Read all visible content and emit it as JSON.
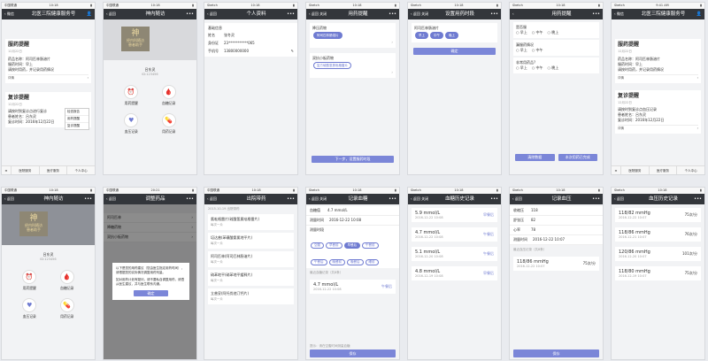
{
  "status": {
    "carrier": "中国联通",
    "carrier2": "中国移动",
    "carrier3": "Sketch"
  },
  "p1": {
    "time": "10:18",
    "back": "微信",
    "title": "北医三院健康服务号",
    "remind_title": "服药提醒",
    "remind_date": "12月22日",
    "drug": "药品名称：阿司匹林肠溶片",
    "time_line": "服药时间：早上",
    "note": "请按时用药，并记录用药情况",
    "detail": "详情",
    "visit_title": "复诊提醒",
    "visit_date": "12月22日",
    "visit_line1": "请按时到复诊点进行复诊",
    "visit_line2": "患者姓名：吕东灵",
    "visit_line3": "复诊时间：2016年12月22日",
    "popup": [
      "检查报告",
      "用药提醒",
      "复诊提醒"
    ],
    "tabs": [
      "≡",
      "医院服务",
      "医疗服务",
      "个人中心"
    ]
  },
  "p2": {
    "time": "10:18",
    "back": "返回",
    "title": "神内随访",
    "badge1": "神",
    "badge2": "经内科随访",
    "badge3": "患者助手",
    "name": "吕东灵",
    "id": "ID:123456",
    "menu": [
      "用药提醒",
      "血糖记录",
      "血压记录",
      "用药记录"
    ]
  },
  "p3": {
    "time": "10:18",
    "back": "返回",
    "title": "个人资料",
    "section": "基础信息",
    "rows": [
      {
        "k": "姓名",
        "v": "张冬灵"
      },
      {
        "k": "身份证",
        "v": "23***********065"
      },
      {
        "k": "手机号",
        "v": "13800000000"
      }
    ]
  },
  "p4": {
    "time": "10:18",
    "back": "返回",
    "close": "关闭",
    "title": "用药提醒",
    "s1": "降压药物",
    "chip1": "阿司匹林肠溶片",
    "s2": "双抗小板药物",
    "chip2": "复方硫酸氢氯吡格雷片",
    "btn": "下一步，设置服药时段"
  },
  "p5": {
    "time": "10:18",
    "back": "返回",
    "close": "关闭",
    "title": "设置用药时段",
    "drug": "阿司匹林肠溶片",
    "chips": [
      "早上",
      "中午",
      "晚上"
    ],
    "btn": "确定"
  },
  "p6": {
    "time": "10:18",
    "title": "用药提醒",
    "q1": "是否服",
    "opts": [
      "早上",
      "中午",
      "晚上"
    ],
    "q2": "漏服药情况",
    "q3": "非常用药品?",
    "cancel": "清除数据",
    "ok": "本次用药已完成"
  },
  "p7": {
    "time": "9:41 AM",
    "back": "微信",
    "title": "北医三院健康服务号",
    "remind_title": "服药提醒",
    "remind_date": "12月22日",
    "drug": "药品名称：阿司匹林肠溶片",
    "time_line": "服药时间：早上",
    "note": "请按时用药，并记录用药情况",
    "detail": "详情",
    "visit_title": "复诊提醒",
    "visit_date": "12月22日",
    "visit_line1": "请按时到复诊点血压记录",
    "visit_line2": "患者姓名：吕东灵",
    "visit_line3": "复诊时间：2016年12月22日",
    "tabs": [
      "≡",
      "医院服务",
      "医疗服务",
      "个人中心"
    ]
  },
  "p8": {
    "time": "10:18",
    "back": "返回",
    "title": "神内随访",
    "badge1": "神",
    "badge2": "经内科随访",
    "badge3": "患者助手",
    "name": "吕东灵",
    "id": "ID:123456",
    "menu": [
      "用药提醒",
      "血糖记录",
      "血压记录",
      "用药记录"
    ]
  },
  "p9": {
    "time": "20:21",
    "back": "返回",
    "title": "调整药品",
    "items": [
      "阿司匹林",
      "降糖药物",
      "双抗小板药物"
    ],
    "dialog1": "以下是您的用药建议（您由医生指定用药时间），请根据您的实际情况调整用药剂量。",
    "dialog2": "如对用药计划有疑问，请不要私自调整用药，请遵从医生建议，并与医生联系沟通。",
    "dialog_btn": "确定"
  },
  "p10": {
    "time": "10:18",
    "back": "返回",
    "title": "出院带药",
    "date": "2015-10-19 出院带药",
    "items": [
      {
        "n": "氯吡格雷片(硫酸氢氯吡格雷片)",
        "f": "每次一片"
      },
      {
        "n": "培达普(苯磺酸氨氯地平片)",
        "f": "每次一片"
      },
      {
        "n": "阿司匹林(阿司匹林肠溶片)",
        "f": "每次一片"
      },
      {
        "n": "硝苯地平(硝苯地平缓释片)",
        "f": "每次一片"
      },
      {
        "n": "立普妥(阿托伐他汀钙片)",
        "f": "每次一片"
      }
    ]
  },
  "p11": {
    "time": "10:18",
    "back": "返回",
    "close": "关闭",
    "title": "记录血糖",
    "val_label": "血糖值",
    "val": "4.7",
    "unit": "mmol/L",
    "date_label": "测量时间",
    "date": "2016-12-22 10:08",
    "period_label": "测量时段",
    "chips": [
      "空腹",
      "早餐前",
      "早餐后",
      "午餐前",
      "午餐后",
      "晚餐前",
      "晚餐后",
      "睡前"
    ],
    "last_label": "最近血糖记录（共8条）",
    "last_val": "4.7 mmol/L",
    "last_tag": "午餐后",
    "last_date": "2016-12-22 10:08",
    "save": "保存",
    "note": "提示：请在空腹时间测量血糖"
  },
  "p12": {
    "time": "10:18",
    "back": "返回",
    "close": "关闭",
    "title": "血糖历史记录",
    "items": [
      {
        "v": "5.9 mmol/L",
        "t": "早餐后",
        "d": "2016-12-22 10:08"
      },
      {
        "v": "4.7 mmol/L",
        "t": "午餐后",
        "d": "2016-12-22 10:08"
      },
      {
        "v": "5.1 mmol/L",
        "t": "午餐后",
        "d": "2016-12-20 10:08"
      },
      {
        "v": "4.8 mmol/L",
        "t": "早餐后",
        "d": "2016-12-19 10:08"
      }
    ]
  },
  "p13": {
    "time": "10:18",
    "back": "返回",
    "title": "记录血压",
    "rows": [
      {
        "k": "收缩压",
        "v": "118"
      },
      {
        "k": "舒张压",
        "v": "82"
      },
      {
        "k": "心率",
        "v": "78"
      },
      {
        "k": "测量时间",
        "v": "2016-12-22 10:07"
      }
    ],
    "last_label": "最近血压记录（共8条）",
    "last_val": "118/86 mmHg",
    "last_rate": "75次/分",
    "last_date": "2016-12-22 10:07",
    "save": "保存"
  },
  "p14": {
    "time": "10:18",
    "back": "返回",
    "title": "血压历史记录",
    "items": [
      {
        "v": "118/82 mmHg",
        "r": "75次/分",
        "d": "2016-12-22 10:07"
      },
      {
        "v": "118/86 mmHg",
        "r": "76次/分",
        "d": "2016-12-21 10:07"
      },
      {
        "v": "120/86 mmHg",
        "r": "101次/分",
        "d": "2016-12-20 10:07"
      },
      {
        "v": "118/80 mmHg",
        "r": "75次/分",
        "d": "2016-12-19 10:07"
      }
    ]
  }
}
